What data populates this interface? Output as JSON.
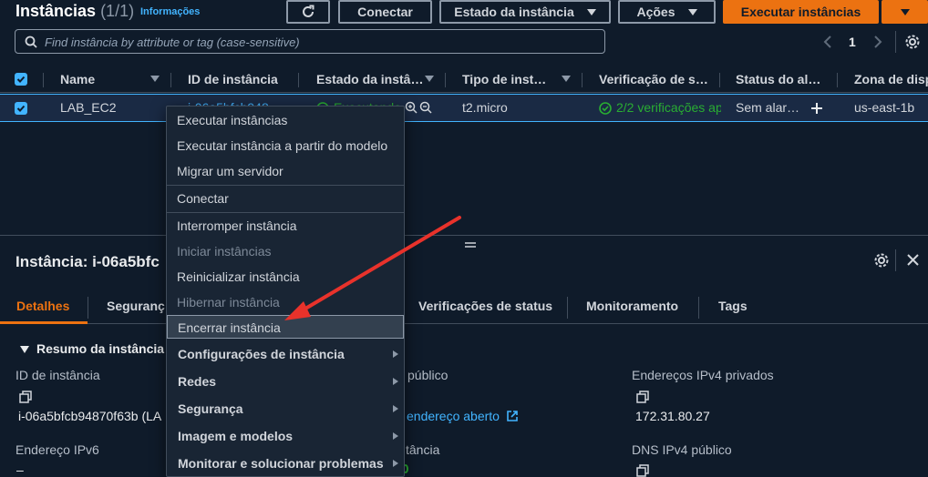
{
  "header": {
    "title": "Instâncias",
    "count": "(1/1)",
    "info_link": "Informações",
    "connect_label": "Conectar",
    "state_label": "Estado da instância",
    "actions_label": "Ações",
    "launch_label": "Executar instâncias"
  },
  "search": {
    "placeholder": "Find instância by attribute or tag (case-sensitive)"
  },
  "pagination": {
    "page": "1"
  },
  "table": {
    "columns": [
      "Name",
      "ID de instância",
      "Estado da instâ…",
      "Tipo de inst…",
      "Verificação de s…",
      "Status do al…",
      "Zona de disp"
    ],
    "row": {
      "name": "LAB_EC2",
      "instance_id": "i-06a5bfcb948",
      "state": "Executando",
      "type": "t2.micro",
      "checks": "2/2 verificações ap",
      "alarm": "Sem alar…",
      "zone": "us-east-1b"
    }
  },
  "panel": {
    "title": "Instância: i-06a5bfc",
    "tabs": [
      "Detalhes",
      "Seguranç",
      "Verificações de status",
      "Monitoramento",
      "Tags"
    ],
    "section_title": "Resumo da instância",
    "fields": {
      "instance_id_label": "ID de instância",
      "instance_id_value": "i-06a5bfcb94870f63b (LA",
      "ipv6_label": "Endereço IPv6",
      "ipv6_value": "–",
      "public_ip_label": "público",
      "open_address": "endereço aberto",
      "state_label_partial": "tância",
      "private_ipv4_label": "Endereços IPv4 privados",
      "private_ipv4_value": "172.31.80.27",
      "public_dns_label": "DNS IPv4 público"
    }
  },
  "context_menu": {
    "items": [
      "Executar instâncias",
      "Executar instância a partir do modelo",
      "Migrar um servidor",
      "Conectar",
      "Interromper instância",
      "Iniciar instâncias",
      "Reinicializar instância",
      "Hibernar instância",
      "Encerrar instância"
    ],
    "submenus": [
      "Configurações de instância",
      "Redes",
      "Segurança",
      "Imagem e modelos",
      "Monitorar e solucionar problemas"
    ]
  },
  "colors": {
    "accent": "#ec7211",
    "link": "#42b4ff",
    "success": "#29ad32",
    "annotation_arrow": "#e8322b"
  }
}
